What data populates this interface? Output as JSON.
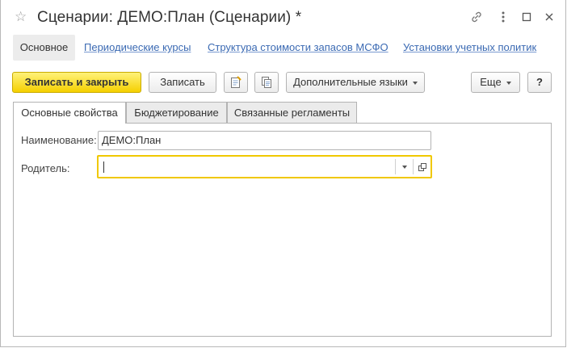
{
  "window": {
    "title": "Сценарии: ДЕМО:План (Сценарии) *",
    "star_icon": "star-icon",
    "controls": [
      "link-icon",
      "more-icon",
      "maximize-icon",
      "close-icon"
    ]
  },
  "nav": {
    "items": [
      {
        "label": "Основное",
        "active": true
      },
      {
        "label": "Периодические курсы",
        "active": false
      },
      {
        "label": "Структура стоимости запасов МСФО",
        "active": false
      },
      {
        "label": "Установки учетных политик",
        "active": false
      }
    ]
  },
  "toolbar": {
    "save_close_label": "Записать и закрыть",
    "save_label": "Записать",
    "extra_languages_label": "Дополнительные языки",
    "more_label": "Еще",
    "help_label": "?"
  },
  "tabs": [
    {
      "label": "Основные свойства",
      "active": true
    },
    {
      "label": "Бюджетирование",
      "active": false
    },
    {
      "label": "Связанные регламенты",
      "active": false
    }
  ],
  "form": {
    "name_label": "Наименование:",
    "name_value": "ДЕМО:План",
    "parent_label": "Родитель:",
    "parent_value": ""
  },
  "colors": {
    "primary_button": "#f5d000",
    "focus_border": "#f0c800",
    "link": "#3b6ab3"
  }
}
